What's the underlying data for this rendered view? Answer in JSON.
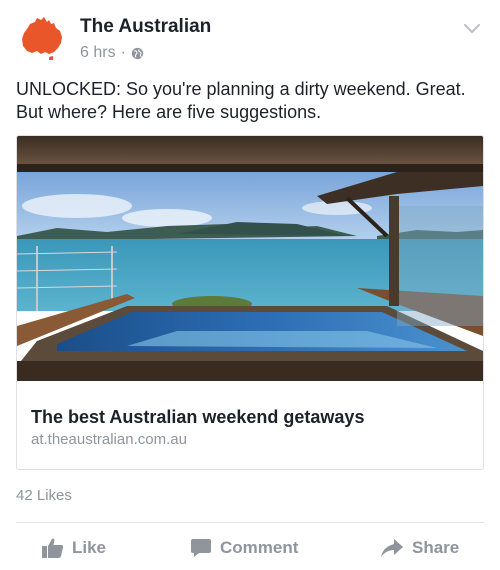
{
  "post": {
    "page_name": "The Australian",
    "time": "6 hrs",
    "separator": "·",
    "privacy_icon": "globe-icon",
    "menu_icon": "chevron-down-icon",
    "message": "UNLOCKED: So you're planning a dirty weekend. Great. But where? Here are five suggestions."
  },
  "link_card": {
    "image_description_icon": "pool-photo",
    "title": "The best Australian weekend getaways",
    "domain": "at.theaustralian.com.au"
  },
  "stats": {
    "likes": "42 Likes"
  },
  "actions": {
    "like": "Like",
    "comment": "Comment",
    "share": "Share"
  },
  "colors": {
    "brand_orange": "#e8562a",
    "muted_text": "#90949c",
    "primary_text": "#1d2129"
  }
}
